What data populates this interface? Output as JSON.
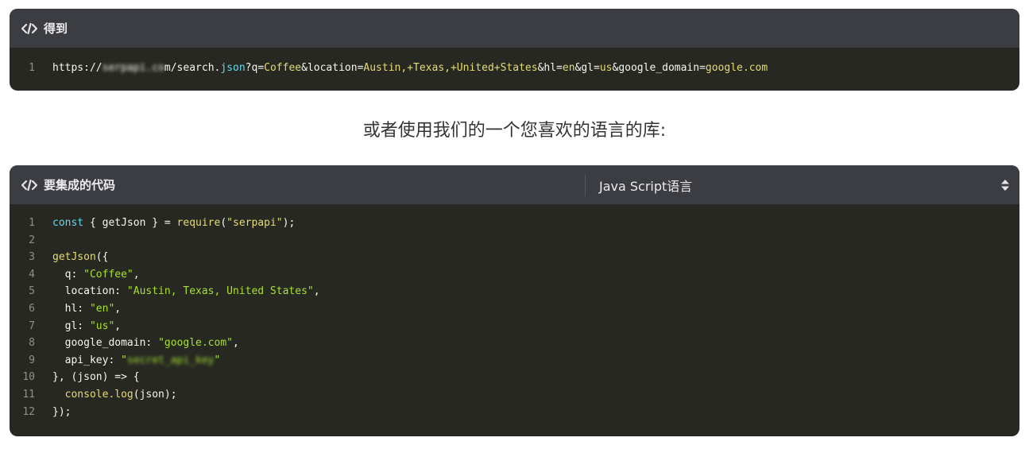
{
  "card1": {
    "title": "得到",
    "icon": "code-icon",
    "line_number": "1",
    "url_parts": {
      "scheme": "https://",
      "host_blurred": "serpapi.co",
      "path": "m/search.",
      "ext": "json",
      "q_key": "?q=",
      "q_val": "Coffee",
      "loc_key": "&location=",
      "loc_val": "Austin,+Texas,+United+States",
      "hl_key": "&hl=",
      "hl_val": "en",
      "gl_key": "&gl=",
      "gl_val": "us",
      "gd_key": "&google_domain=",
      "gd_val": "google.com"
    }
  },
  "middle_text": "或者使用我们的一个您喜欢的语言的库:",
  "card2": {
    "title": "要集成的代码",
    "icon": "code-icon",
    "language": "Java Script语言",
    "line_numbers": [
      "1",
      "2",
      "3",
      "4",
      "5",
      "6",
      "7",
      "8",
      "9",
      "10",
      "11",
      "12"
    ],
    "code": {
      "l1_kw": "const",
      "l1_mid": " { getJson } = ",
      "l1_fn": "require",
      "l1_open": "(",
      "l1_str": "\"serpapi\"",
      "l1_end": ");",
      "l3_fn": "getJson",
      "l3_end": "({",
      "l4_key": "  q: ",
      "l4_val": "\"Coffee\"",
      "l4_end": ",",
      "l5_key": "  location: ",
      "l5_val": "\"Austin, Texas, United States\"",
      "l5_end": ",",
      "l6_key": "  hl: ",
      "l6_val": "\"en\"",
      "l6_end": ",",
      "l7_key": "  gl: ",
      "l7_val": "\"us\"",
      "l7_end": ",",
      "l8_key": "  google_domain: ",
      "l8_val": "\"google.com\"",
      "l8_end": ",",
      "l9_key": "  api_key: ",
      "l9_q1": "\"",
      "l9_val_blurred": "secret_api_key",
      "l9_q2": "\"",
      "l10": "}, (json) => {",
      "l11_fn": "  console.log",
      "l11_end": "(json);",
      "l12": "});"
    }
  },
  "colors": {
    "code_bg": "#272822",
    "header_bg": "#3b3d42",
    "keyword": "#66d9ef",
    "function": "#e6db74",
    "string": "#a6e22e"
  }
}
